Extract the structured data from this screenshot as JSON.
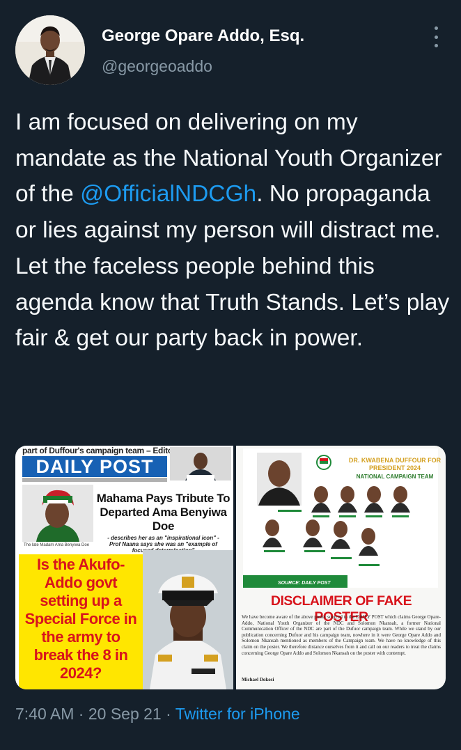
{
  "author": {
    "name": "George Opare Addo, Esq.",
    "handle": "@georgeoaddo",
    "avatar_icon": "profile-photo"
  },
  "more_icon": "more-options-icon",
  "tweet": {
    "text_before": "I am focused on delivering on my mandate as the National Youth Organizer of the ",
    "mention": "@OfficialNDCGh",
    "text_after": ". No propaganda or lies against my person will distract me. Let the faceless people behind this agenda know that Truth Stands. Let’s play fair & get our party back in power."
  },
  "media": {
    "left": {
      "strap": "part of Duffour's campaign team – Editor",
      "logo": "DAILY POST",
      "headline": "Mahama Pays Tribute To Departed Ama Benyiwa Doe",
      "subhead": "- describes her as an \"inspirational icon\" - Prof Naana says she was an \"example of focused determination\"",
      "caption": "The late Madam Ama Benyiwa Doe",
      "yellow_text": "Is the Akufo-Addo govt setting up a Special Force in the army to break the 8 in 2024?"
    },
    "right": {
      "title": "DR. KWABENA DUFFOUR FOR PRESIDENT 2024",
      "subtitle": "NATIONAL CAMPAIGN TEAM",
      "source": "SOURCE: DAILY POST",
      "disclaimer": "DISCLAIMER OF FAKE POSTER",
      "paragraph": "We have become aware of the above poster sourced to the DAILY POST which claims George Opare-Addo, National Youth Organizer of the NDC and Solomon Nkansah, a former National Communication Officer of the NDC are part of the Dufuor campaign team. While we stand by our publication concerning Dufuor and his campaign team, nowhere in it were George Opare Addo and Solomon Nkansah mentioned as members of the Campaign team. We have no knowledge of this claim on the poster. We therefore distance ourselves from it and call on our readers to treat the claims concerning George Opare Addo and Solomon Nkansah on the poster with contempt.",
      "signature": "Michael Dokosi"
    }
  },
  "meta": {
    "time": "7:40 AM",
    "separator": " · ",
    "date": "20 Sep 21",
    "source": "Twitter for iPhone"
  },
  "colors": {
    "background": "#15202b",
    "link": "#1d9bf0",
    "secondary": "#8899a6"
  }
}
